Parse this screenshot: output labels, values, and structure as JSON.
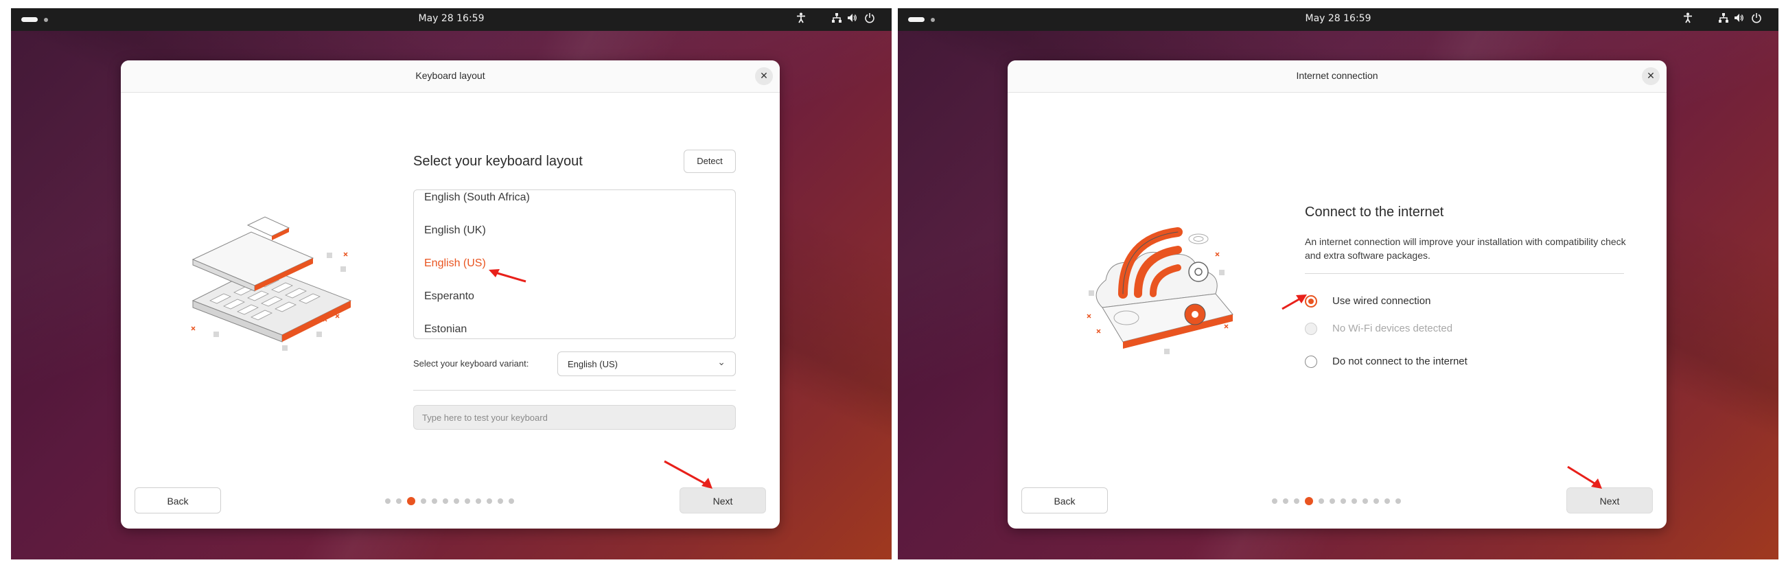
{
  "topbar": {
    "clock": "May 28  16:59"
  },
  "left_window": {
    "title": "Keyboard layout",
    "heading": "Select your keyboard layout",
    "detect_label": "Detect",
    "layouts": [
      "English (South Africa)",
      "English (UK)",
      "English (US)",
      "Esperanto",
      "Estonian"
    ],
    "selected_layout": "English (US)",
    "variant_label": "Select your keyboard variant:",
    "variant_value": "English (US)",
    "test_placeholder": "Type here to test your keyboard",
    "back_label": "Back",
    "next_label": "Next",
    "progress": {
      "total": 12,
      "current": 3
    }
  },
  "right_window": {
    "title": "Internet connection",
    "heading": "Connect to the internet",
    "description": "An internet connection will improve your installation with compatibility check and extra software packages.",
    "options": [
      {
        "label": "Use wired connection",
        "state": "checked"
      },
      {
        "label": "No Wi-Fi devices detected",
        "state": "disabled"
      },
      {
        "label": "Do not connect to the internet",
        "state": "unchecked"
      }
    ],
    "back_label": "Back",
    "next_label": "Next",
    "progress": {
      "total": 12,
      "current": 4
    }
  },
  "colors": {
    "accent": "#e95420",
    "annotation_arrow": "#e8201a",
    "topbar": "#1d1d1d"
  },
  "icons": [
    "accessibility-icon",
    "network-icon",
    "volume-icon",
    "power-icon",
    "close-icon",
    "chevron-down-icon"
  ]
}
